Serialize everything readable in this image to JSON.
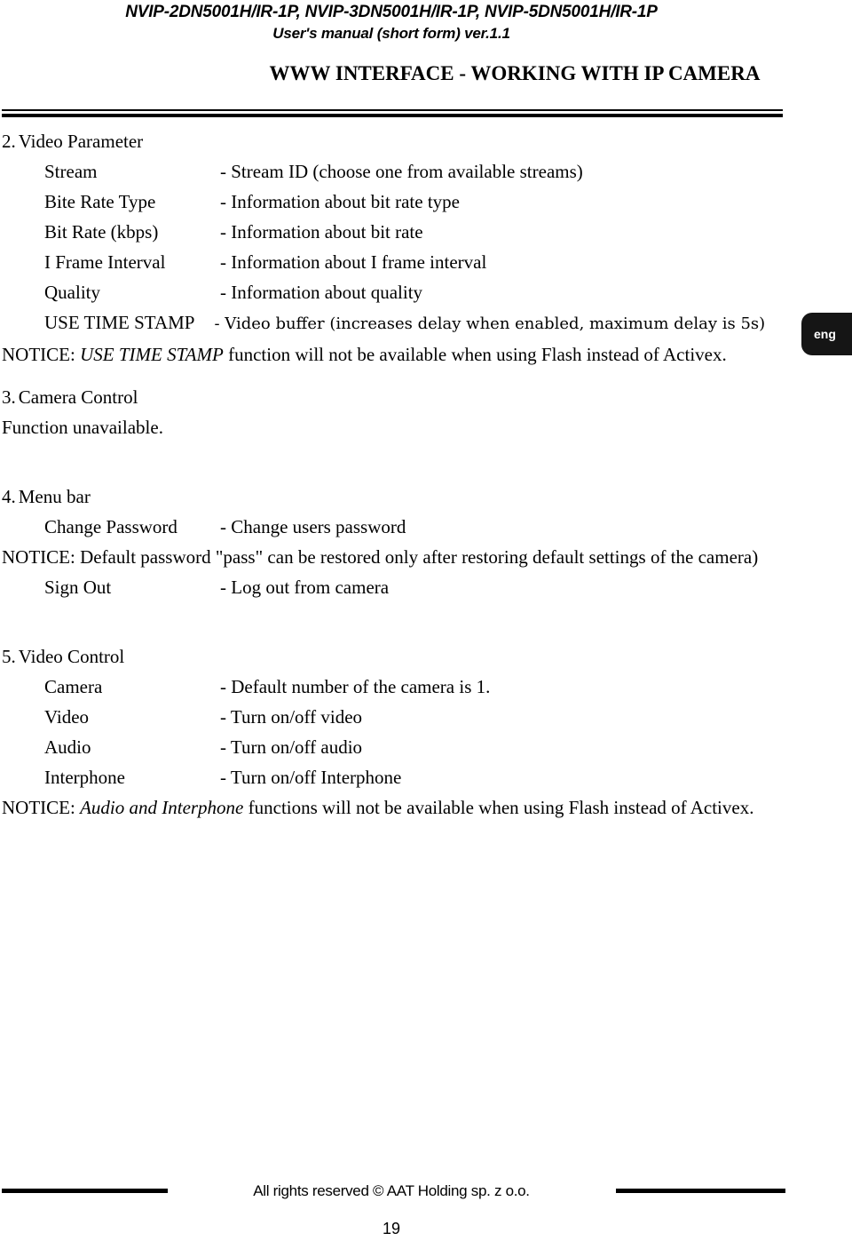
{
  "header": {
    "models_line": "NVIP-2DN5001H/IR-1P, NVIP-3DN5001H/IR-1P, NVIP-5DN5001H/IR-1P",
    "manual_line": "User's manual (short form) ver.1.1",
    "section_title": "WWW INTERFACE - WORKING WITH IP CAMERA"
  },
  "language_tab": {
    "label": "eng"
  },
  "sections": {
    "video_parameter": {
      "number": "2.",
      "title": "Video Parameter",
      "rows": [
        {
          "label": "Stream",
          "desc": "- Stream ID (choose one from available streams)"
        },
        {
          "label": "Bite Rate Type",
          "desc": "- Information about bit rate type"
        },
        {
          "label": "Bit Rate (kbps)",
          "desc": "- Information about bit rate"
        },
        {
          "label": "I Frame Interval",
          "desc": "- Information about I frame interval"
        },
        {
          "label": "Quality",
          "desc": "- Information about quality"
        },
        {
          "label": "USE TIME STAMP",
          "desc": "- Video buffer (increases delay when enabled, maximum delay is 5s)"
        }
      ],
      "notice": {
        "prefix": "NOTICE: ",
        "italic": "USE TIME STAMP",
        "suffix": " function will not be available when using Flash instead of Activex."
      }
    },
    "camera_control": {
      "number": "3.",
      "title": "Camera Control",
      "body": "Function unavailable."
    },
    "menu_bar": {
      "number": "4.",
      "title": "Menu bar",
      "rows": [
        {
          "label": "Change Password",
          "desc": "- Change users password"
        },
        {
          "label": "Sign Out",
          "desc": "- Log out from camera"
        }
      ],
      "notice": {
        "text": "NOTICE: Default password \"pass\" can be restored only after restoring default settings of the camera)"
      }
    },
    "video_control": {
      "number": "5.",
      "title": "Video Control",
      "rows": [
        {
          "label": "Camera",
          "desc": "- Default number of the camera is 1."
        },
        {
          "label": "Video",
          "desc": "- Turn on/off video"
        },
        {
          "label": "Audio",
          "desc": "- Turn on/off audio"
        },
        {
          "label": "Interphone",
          "desc": "- Turn on/off Interphone"
        }
      ],
      "notice": {
        "prefix": "NOTICE: ",
        "italic": "Audio and Interphone",
        "suffix": " functions will not be available when using Flash instead of Activex."
      }
    }
  },
  "footer": {
    "copyright": "All rights reserved © AAT Holding sp. z o.o.",
    "page_number": "19"
  }
}
